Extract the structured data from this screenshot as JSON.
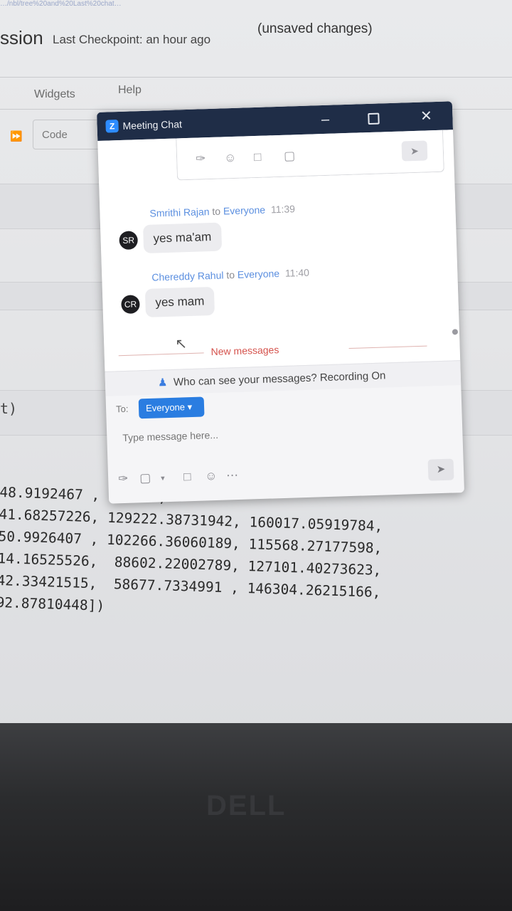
{
  "notebook": {
    "url_fragment": "…/nbl/tree%20and%20Last%20chat…",
    "name_fragment": "ssion",
    "checkpoint": "Last Checkpoint: an hour ago",
    "unsaved": "(unsaved changes)",
    "menu": {
      "widgets": "Widgets",
      "help": "Help"
    },
    "toolbar": {
      "cell_type": "Code"
    },
    "code_fragment": "t)",
    "output_lines": [
      "48.9192467 ,  …,  …,",
      "41.68257226, 129222.38731942, 160017.05919784,",
      "50.9926407 , 102266.36060189, 115568.27177598,",
      "14.16525526,  88602.22002789, 127101.40273623,",
      "42.33421515,  58677.7334991 , 146304.26215166,",
      "92.87810448])"
    ]
  },
  "chat": {
    "title": "Meeting Chat",
    "messages": [
      {
        "sender": "Smrithi Rajan",
        "to_word": "to",
        "recipient": "Everyone",
        "time": "11:39",
        "initials": "SR",
        "text": "yes ma'am"
      },
      {
        "sender": "Chereddy Rahul",
        "to_word": "to",
        "recipient": "Everyone",
        "time": "11:40",
        "initials": "CR",
        "text": "yes mam"
      }
    ],
    "new_messages": "New messages",
    "notice": "Who can see your messages? Recording On",
    "to_label": "To:",
    "recipient_select": "Everyone",
    "input_placeholder": "Type message here..."
  },
  "device": {
    "brand": "DELL"
  },
  "colors": {
    "titlebar": "#1f2d47",
    "accent": "#2a7de1",
    "new_messages": "#d5534d"
  }
}
